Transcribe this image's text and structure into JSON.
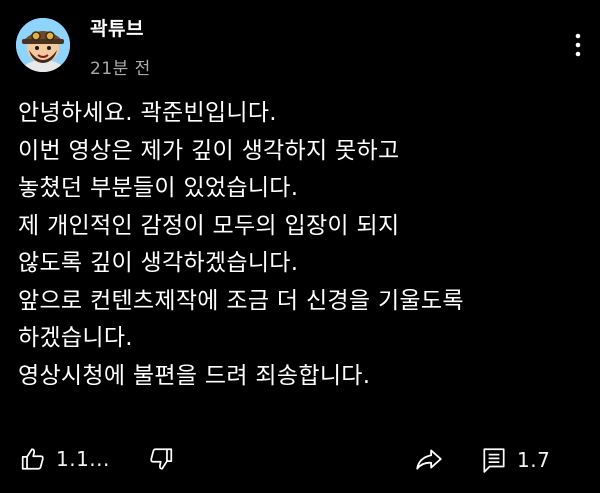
{
  "post": {
    "channel_name": "곽튜브",
    "timestamp": "21분 전",
    "avatar_icon": "cartoon-avatar-icon",
    "more_icon": "more-vertical-icon",
    "body_lines": [
      "안녕하세요. 곽준빈입니다.",
      "이번 영상은 제가 깊이 생각하지 못하고",
      "놓쳤던 부분들이 있었습니다.",
      "제 개인적인 감정이 모두의 입장이 되지",
      "않도록 깊이 생각하겠습니다.",
      "앞으로 컨텐츠제작에 조금 더 신경을 기울도록",
      "하겠습니다.",
      "영상시청에 불편을 드려 죄송합니다."
    ]
  },
  "actions": {
    "like_icon": "thumbs-up-icon",
    "like_count": "1.1...",
    "dislike_icon": "thumbs-down-icon",
    "share_icon": "share-icon",
    "comment_icon": "comment-icon",
    "comment_count": "1.7"
  },
  "colors": {
    "background": "#000000",
    "primary_text": "#ffffff",
    "secondary_text": "#aaaaaa"
  }
}
